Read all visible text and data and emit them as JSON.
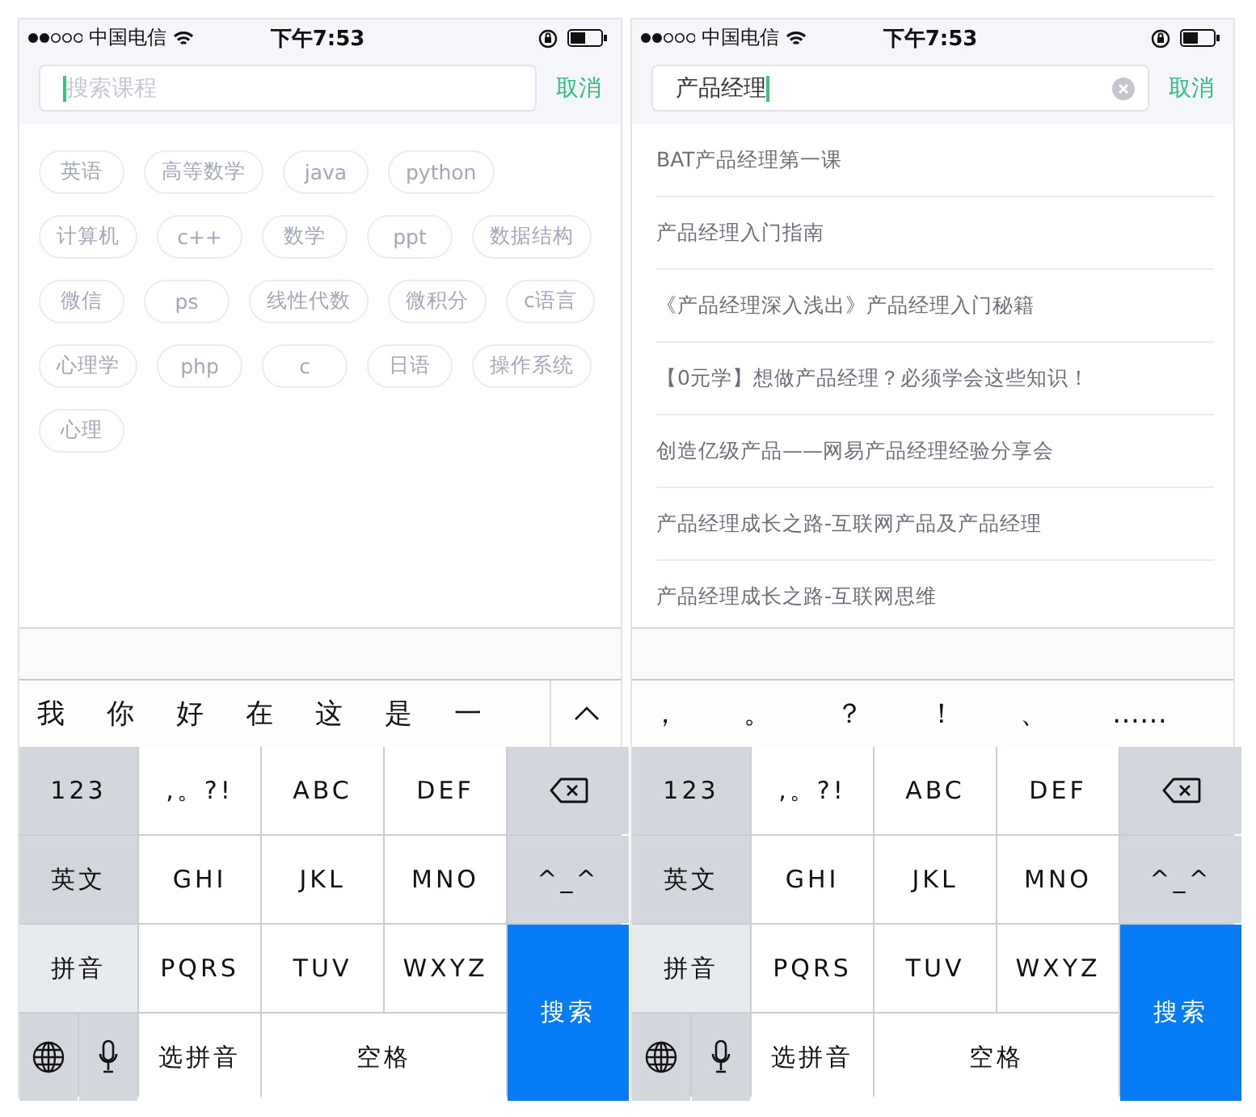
{
  "screens": [
    {
      "status_bar": {
        "carrier": "中国电信",
        "time": "下午7:53"
      },
      "search": {
        "placeholder": "搜索课程",
        "clear_button": false,
        "cancel": "取消"
      },
      "hot_tags": [
        "英语",
        "高等数学",
        "java",
        "python",
        "计算机",
        "c++",
        "数学",
        "ppt",
        "数据结构",
        "微信",
        "ps",
        "线性代数",
        "微积分",
        "c语言",
        "心理学",
        "php",
        "c",
        "日语",
        "操作系统",
        "心理"
      ],
      "candidates": {
        "items": [
          "我",
          "你",
          "好",
          "在",
          "这",
          "是",
          "一"
        ],
        "expand_button": true
      },
      "keyboard": [
        {
          "kind": "mode",
          "label": "123",
          "selected": false
        },
        {
          "kind": "char",
          "label": ",。?!"
        },
        {
          "kind": "char",
          "label": "ABC"
        },
        {
          "kind": "char",
          "label": "DEF"
        },
        {
          "kind": "backspace"
        },
        {
          "kind": "mode",
          "label": "英文",
          "selected": false
        },
        {
          "kind": "char",
          "label": "GHI"
        },
        {
          "kind": "char",
          "label": "JKL"
        },
        {
          "kind": "char",
          "label": "MNO"
        },
        {
          "kind": "side",
          "label": "^_^"
        },
        {
          "kind": "mode",
          "label": "拼音",
          "selected": true
        },
        {
          "kind": "char",
          "label": "PQRS"
        },
        {
          "kind": "char",
          "label": "TUV"
        },
        {
          "kind": "char",
          "label": "WXYZ"
        },
        {
          "kind": "return",
          "label": "搜索"
        },
        {
          "kind": "globe"
        },
        {
          "kind": "mic"
        },
        {
          "kind": "char",
          "label": "选拼音"
        },
        {
          "kind": "space",
          "label": "空格"
        }
      ]
    },
    {
      "status_bar": {
        "carrier": "中国电信",
        "time": "下午7:53"
      },
      "search": {
        "value": "产品经理",
        "clear_button": true,
        "cancel": "取消"
      },
      "results": [
        "BAT产品经理第一课",
        "产品经理入门指南",
        "《产品经理深入浅出》产品经理入门秘籍",
        "【0元学】想做产品经理？必须学会这些知识！",
        "创造亿级产品——网易产品经理经验分享会",
        "产品经理成长之路-互联网产品及产品经理",
        "产品经理成长之路-互联网思维"
      ],
      "candidates": {
        "items": [
          "，",
          "。",
          "？",
          "！",
          "、",
          "……"
        ],
        "expand_button": false
      },
      "keyboard": [
        {
          "kind": "mode",
          "label": "123",
          "selected": false
        },
        {
          "kind": "char",
          "label": ",。?!"
        },
        {
          "kind": "char",
          "label": "ABC"
        },
        {
          "kind": "char",
          "label": "DEF"
        },
        {
          "kind": "backspace"
        },
        {
          "kind": "mode",
          "label": "英文",
          "selected": false
        },
        {
          "kind": "char",
          "label": "GHI"
        },
        {
          "kind": "char",
          "label": "JKL"
        },
        {
          "kind": "char",
          "label": "MNO"
        },
        {
          "kind": "side",
          "label": "^_^"
        },
        {
          "kind": "mode",
          "label": "拼音",
          "selected": true
        },
        {
          "kind": "char",
          "label": "PQRS"
        },
        {
          "kind": "char",
          "label": "TUV"
        },
        {
          "kind": "char",
          "label": "WXYZ"
        },
        {
          "kind": "return",
          "label": "搜索"
        },
        {
          "kind": "globe"
        },
        {
          "kind": "mic"
        },
        {
          "kind": "char",
          "label": "选拼音"
        },
        {
          "kind": "space",
          "label": "空格"
        }
      ]
    }
  ]
}
